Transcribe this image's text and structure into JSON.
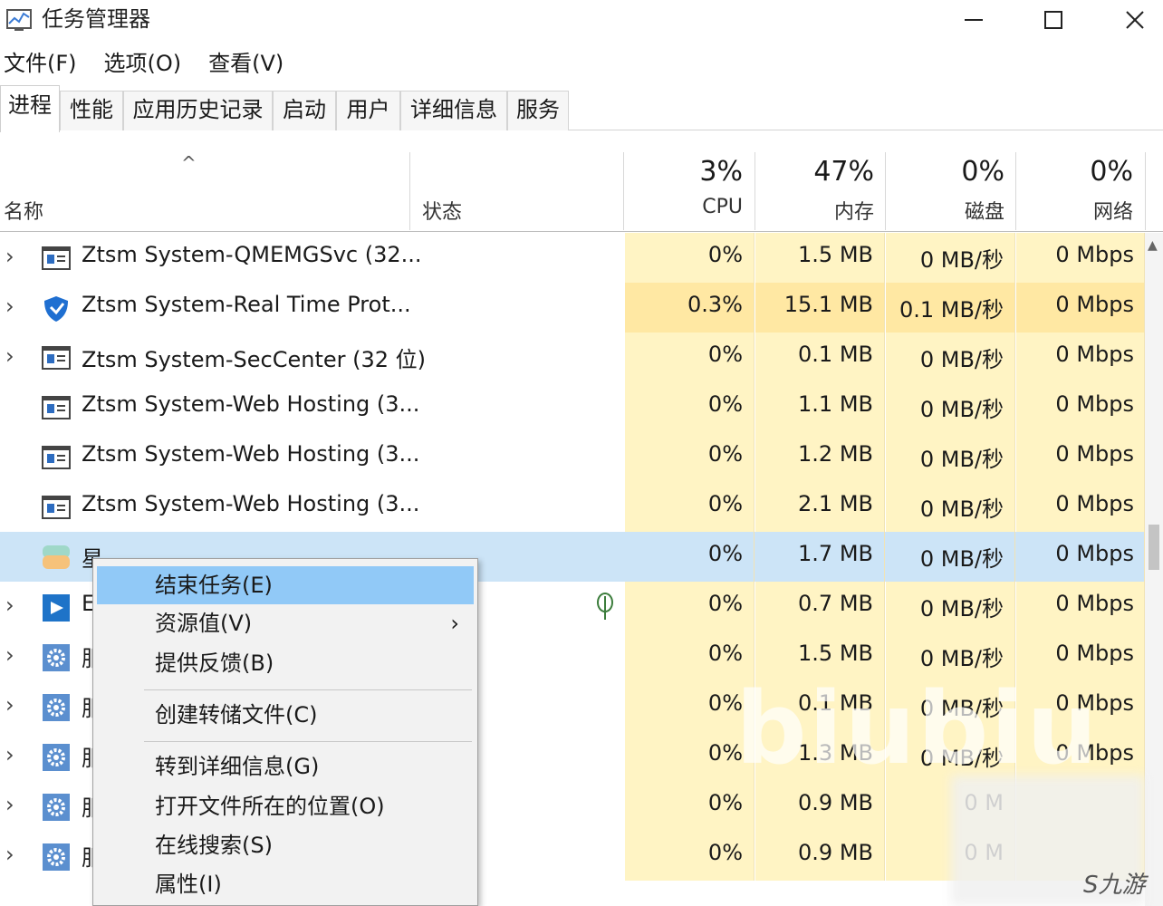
{
  "window": {
    "title": "任务管理器",
    "icon": "task-manager-icon"
  },
  "menu": [
    "文件(F)",
    "选项(O)",
    "查看(V)"
  ],
  "tabs": [
    "进程",
    "性能",
    "应用历史记录",
    "启动",
    "用户",
    "详细信息",
    "服务"
  ],
  "active_tab": "进程",
  "columns": {
    "name": "名称",
    "status": "状态",
    "cpu": {
      "percent": "3%",
      "label": "CPU"
    },
    "memory": {
      "percent": "47%",
      "label": "内存"
    },
    "disk": {
      "percent": "0%",
      "label": "磁盘"
    },
    "network": {
      "percent": "0%",
      "label": "网络"
    }
  },
  "processes": [
    {
      "name": "Ztsm System-QMEMGSvc (32...",
      "cpu": "0%",
      "memory": "1.5 MB",
      "disk": "0 MB/秒",
      "network": "0 Mbps",
      "icon": "service-window-icon",
      "expandable": true
    },
    {
      "name": "Ztsm System-Real Time Prot...",
      "cpu": "0.3%",
      "memory": "15.1 MB",
      "disk": "0.1 MB/秒",
      "network": "0 Mbps",
      "icon": "shield-icon",
      "expandable": true
    },
    {
      "name": "Ztsm System-SecCenter (32 位)",
      "cpu": "0%",
      "memory": "0.1 MB",
      "disk": "0 MB/秒",
      "network": "0 Mbps",
      "icon": "service-window-icon",
      "expandable": true
    },
    {
      "name": "Ztsm System-Web Hosting (3...",
      "cpu": "0%",
      "memory": "1.1 MB",
      "disk": "0 MB/秒",
      "network": "0 Mbps",
      "icon": "service-window-icon",
      "expandable": false
    },
    {
      "name": "Ztsm System-Web Hosting (3...",
      "cpu": "0%",
      "memory": "1.2 MB",
      "disk": "0 MB/秒",
      "network": "0 Mbps",
      "icon": "service-window-icon",
      "expandable": false
    },
    {
      "name": "Ztsm System-Web Hosting (3...",
      "cpu": "0%",
      "memory": "2.1 MB",
      "disk": "0 MB/秒",
      "network": "0 Mbps",
      "icon": "service-window-icon",
      "expandable": false
    },
    {
      "name": "星",
      "cpu": "0%",
      "memory": "1.7 MB",
      "disk": "0 MB/秒",
      "network": "0 Mbps",
      "icon": "app-colorful-icon",
      "expandable": false,
      "selected": true
    },
    {
      "name": "E",
      "cpu": "0%",
      "memory": "0.7 MB",
      "disk": "0 MB/秒",
      "network": "0 Mbps",
      "icon": "blue-app-icon",
      "expandable": true,
      "status_icon": "leaf-icon"
    },
    {
      "name": "服",
      "cpu": "0%",
      "memory": "1.5 MB",
      "disk": "0 MB/秒",
      "network": "0 Mbps",
      "icon": "gear-service-icon",
      "expandable": true
    },
    {
      "name": "服",
      "cpu": "0%",
      "memory": "0.1 MB",
      "disk": "0 MB/秒",
      "network": "0 Mbps",
      "icon": "gear-service-icon",
      "expandable": true
    },
    {
      "name": "服",
      "cpu": "0%",
      "memory": "1.3 MB",
      "disk": "0 MB/秒",
      "network": "0 Mbps",
      "icon": "gear-service-icon",
      "expandable": true
    },
    {
      "name": "服",
      "cpu": "0%",
      "memory": "0.9 MB",
      "disk": "0 M",
      "network": "",
      "icon": "gear-service-icon",
      "expandable": true
    },
    {
      "name": "服",
      "cpu": "0%",
      "memory": "0.9 MB",
      "disk": "0 M",
      "network": "",
      "icon": "gear-service-icon",
      "expandable": true
    }
  ],
  "context_menu": {
    "items": [
      {
        "label": "结束任务(E)",
        "highlighted": true
      },
      {
        "label": "资源值(V)",
        "submenu": true
      },
      {
        "label": "提供反馈(B)"
      },
      {
        "label": "创建转储文件(C)"
      },
      {
        "label": "转到详细信息(G)"
      },
      {
        "label": "打开文件所在的位置(O)"
      },
      {
        "label": "在线搜索(S)"
      },
      {
        "label": "属性(I)"
      }
    ],
    "submenu_arrow": "›"
  },
  "watermark": {
    "text": "biubiu",
    "logo": "九游"
  },
  "colors": {
    "heat_light": "#fff4c4",
    "heat_medium": "#ffe8a3",
    "selected_row": "#cce4f7",
    "menu_highlight": "#91c9f7"
  }
}
